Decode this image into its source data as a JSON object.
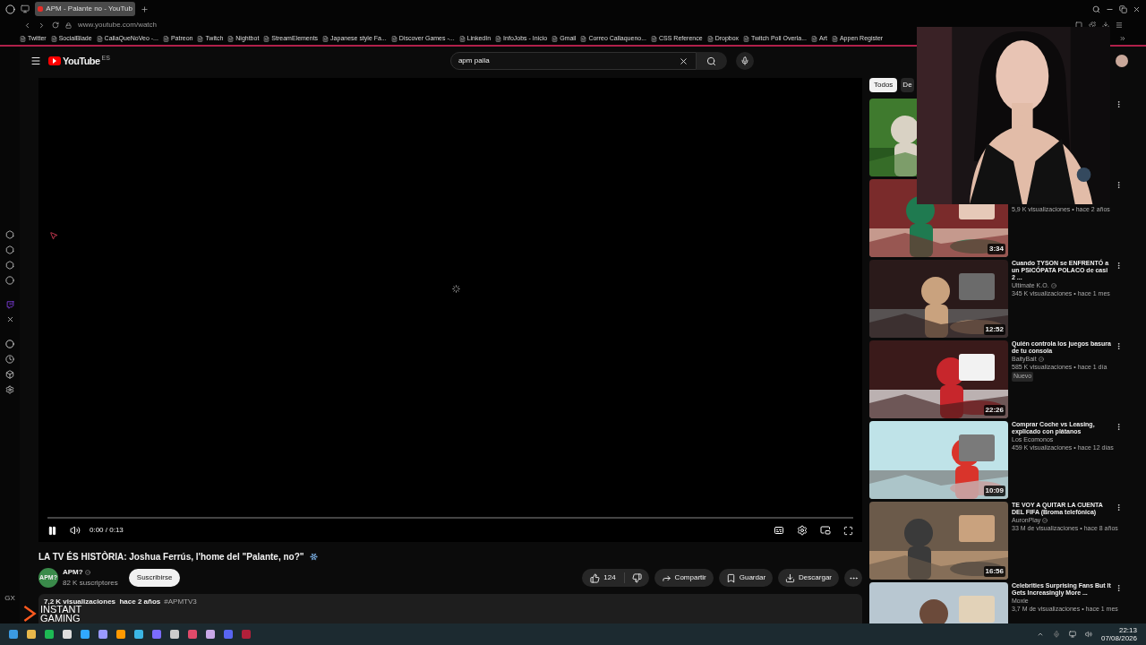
{
  "browser": {
    "tab": {
      "title": "APM - Palante no - YouTub",
      "selected": true
    },
    "url": "www.youtube.com/watch",
    "bookmarks": [
      "Twitter",
      "SocialBlade",
      "CallaQueNoVeo -...",
      "Patreon",
      "Twitch",
      "Nightbot",
      "StreamElements",
      "Japanese style Fa...",
      "Discover Games -...",
      "LinkedIn",
      "InfoJobs - Inicio",
      "Gmail",
      "Correo Callaqueno...",
      "CSS Reference",
      "Dropbox",
      "Twitch Poll Overla...",
      "Art",
      "Appen Register"
    ],
    "sidebar_label": "GX"
  },
  "youtube": {
    "logo": "YouTube",
    "region": "ES",
    "search": {
      "value": "apm palla"
    }
  },
  "player": {
    "playing": true,
    "time": "0:00 / 0:13"
  },
  "video": {
    "title": "LA TV ÉS HISTÒRIA: Joshua Ferrús, l'home del \"Palante, no?\"",
    "channel": "APM?",
    "channel_logo": "APM?",
    "subscribers": "82 K suscriptores",
    "subscribe": "Suscribirse",
    "likes": "124",
    "actions": [
      "Compartir",
      "Guardar",
      "Descargar"
    ],
    "description": {
      "stats": "7,2 K visualizaciones  hace 2 años",
      "hashtag": "#APMTV3"
    }
  },
  "chips": [
    {
      "label": "Todos",
      "selected": true
    },
    {
      "label": "De",
      "selected": false
    }
  ],
  "recommendations": [
    {
      "thumbnail": {
        "kind": "picture"
      }
    },
    {
      "thumbnail": {
        "kind": "picture"
      },
      "duration": "3:34",
      "meta": "5,9 K visualizaciones • hace 2 años"
    },
    {
      "thumbnail": {
        "kind": "picture"
      },
      "duration": "12:52",
      "title": "Cuando TYSON se ENFRENTÓ a un PSICÓPATA POLACO de casi 2 ...",
      "channel": "Ultimate K.O.",
      "verified": true,
      "meta": "345 K visualizaciones • hace 1 mes"
    },
    {
      "thumbnail": {
        "kind": "picture"
      },
      "duration": "22:26",
      "title": "Quién controla los juegos basura de tu consola",
      "channel": "BaityBait",
      "verified": true,
      "meta": "585 K visualizaciones • hace 1 día",
      "badge": "Nuevo"
    },
    {
      "thumbnail": {
        "kind": "picture"
      },
      "duration": "10:09",
      "title": "Comprar Coche vs Leasing, explicado con plátanos",
      "channel": "Los Ecomonos",
      "verified": false,
      "meta": "459 K visualizaciones • hace 12 días"
    },
    {
      "thumbnail": {
        "kind": "picture"
      },
      "duration": "16:56",
      "title": "TE VOY A QUITAR LA CUENTA DEL FIFA (Broma telefónica)",
      "channel": "AuronPlay",
      "verified": true,
      "meta": "33 M de visualizaciones • hace 8 años"
    },
    {
      "thumbnail": {
        "kind": "picture"
      },
      "title": "Celebrities Surprising Fans But It Gets Increasingly More ...",
      "channel": "Moxie",
      "verified": false,
      "meta": "3,7 M de visualizaciones • hace 1 mes"
    }
  ],
  "overlay": {
    "webcam": {
      "kind": "picture"
    },
    "sponsor": "INSTANT GAMING"
  },
  "taskbar": {
    "time": "22:13",
    "date": "07/08/2026"
  }
}
